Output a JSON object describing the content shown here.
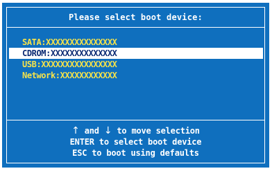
{
  "dialog": {
    "title": "Please select boot device:"
  },
  "devices": [
    {
      "label": "SATA:XXXXXXXXXXXXXXX",
      "selected": false
    },
    {
      "label": "CDROM:XXXXXXXXXXXXXX",
      "selected": true
    },
    {
      "label": "USB:XXXXXXXXXXXXXXXX",
      "selected": false
    },
    {
      "label": "Network:XXXXXXXXXXXX",
      "selected": false
    }
  ],
  "help": {
    "line1_up_arrow": "↑",
    "line1_and": "and",
    "line1_down_arrow": "↓",
    "line1_rest": "to move selection",
    "line2": "ENTER to select boot device",
    "line3": "ESC to boot using defaults"
  },
  "colors": {
    "background": "#0f6fbe",
    "item_text": "#f6e34a",
    "selected_bg": "#ffffff",
    "selected_text": "#0b2a73",
    "border": "#ffffff"
  }
}
